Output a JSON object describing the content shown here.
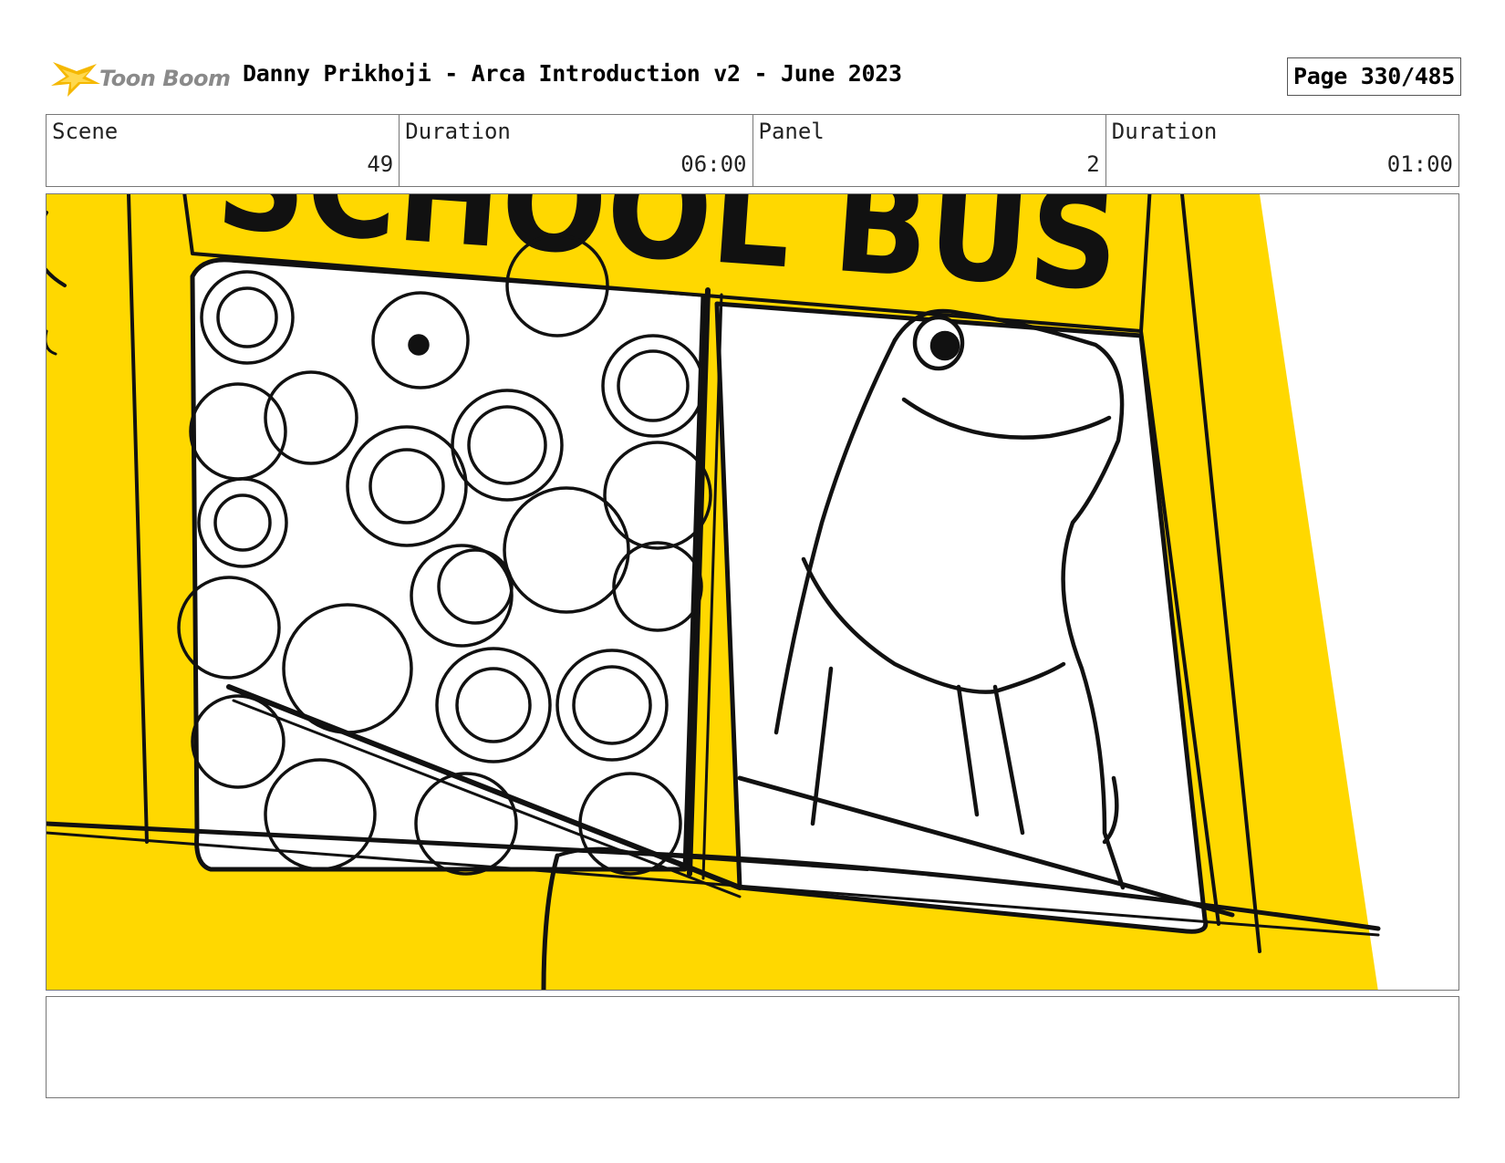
{
  "header": {
    "logo_text": "Toon Boom",
    "title": "Danny Prikhoji - Arca Introduction v2 - June 2023",
    "page_label": "Page 330/485"
  },
  "info": {
    "scene_label": "Scene",
    "scene_value": "49",
    "scene_duration_label": "Duration",
    "scene_duration_value": "06:00",
    "panel_label": "Panel",
    "panel_value": "2",
    "panel_duration_label": "Duration",
    "panel_duration_value": "01:00"
  },
  "panel": {
    "sign_text": "SCHOOL BUS",
    "colors": {
      "bus_yellow": "#FFD800",
      "ink": "#111111"
    }
  },
  "notes": {
    "text": ""
  }
}
